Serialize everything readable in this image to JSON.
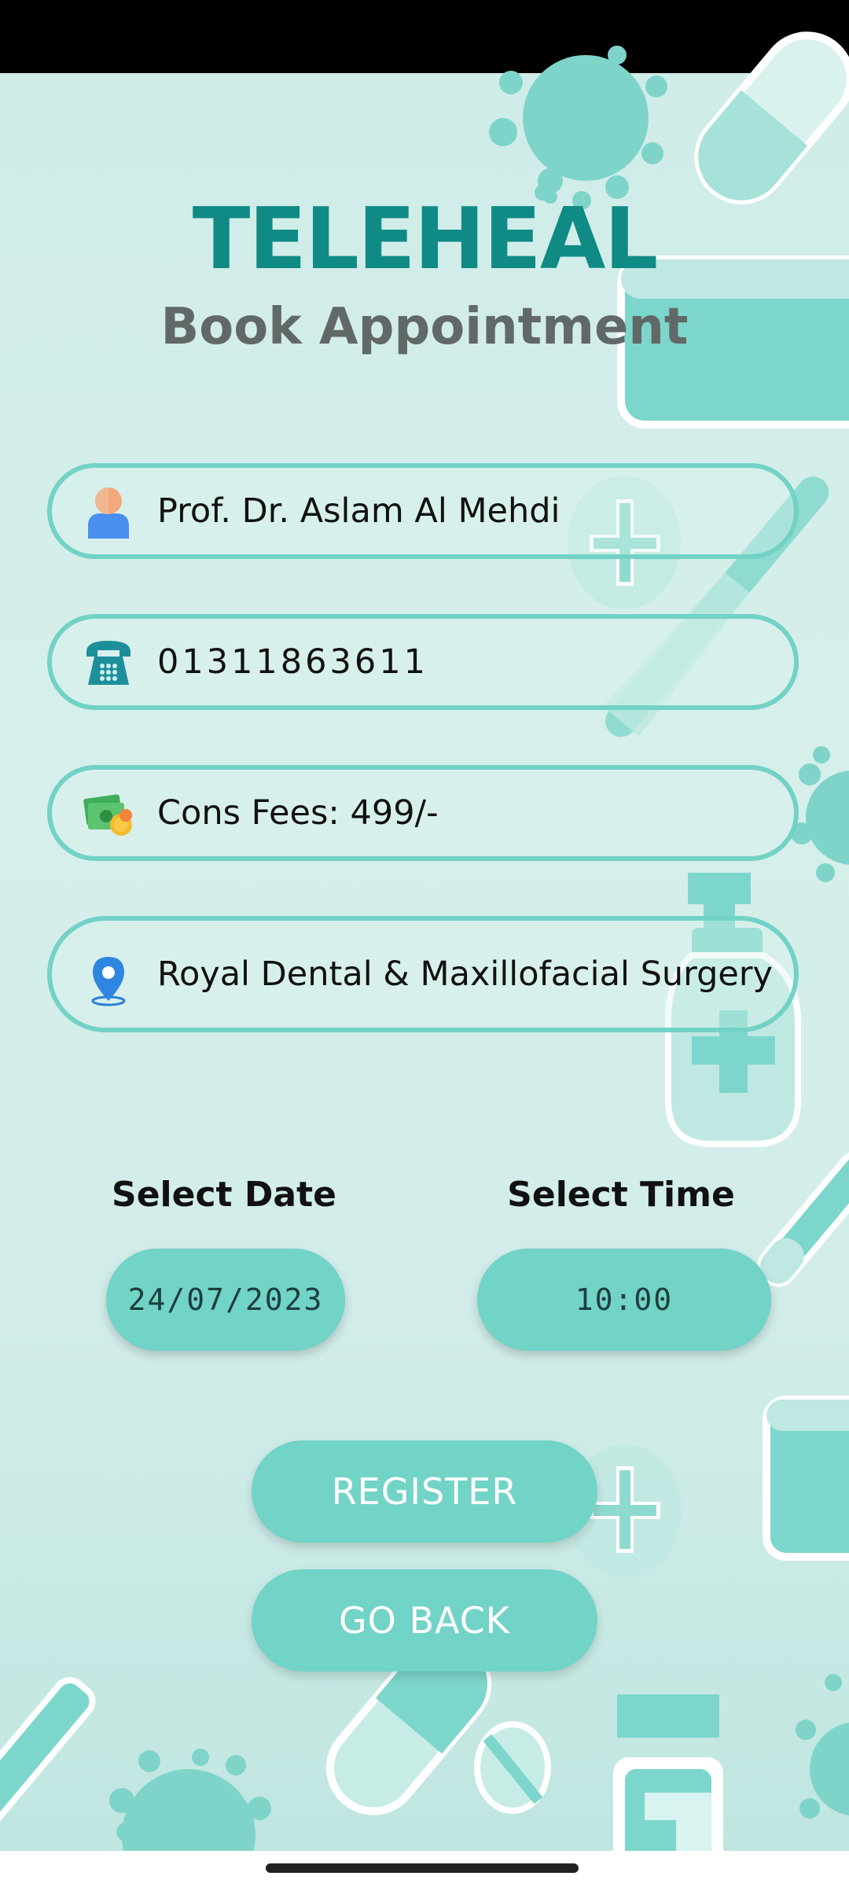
{
  "app": {
    "name": "TELEHEAL",
    "page_title": "Book Appointment"
  },
  "doctor": {
    "name": "Prof. Dr. Aslam Al Mehdi",
    "phone": "01311863611",
    "fees": "Cons Fees: 499/-",
    "location": "Royal Dental & Maxillofacial Surgery"
  },
  "icons": {
    "doctor": "person-icon",
    "phone": "telephone-icon",
    "fees": "money-icon",
    "location": "location-pin-icon"
  },
  "schedule": {
    "date_label": "Select Date",
    "date_value": "24/07/2023",
    "time_label": "Select Time",
    "time_value": "10:00"
  },
  "actions": {
    "register": "REGISTER",
    "go_back": "GO BACK"
  },
  "colors": {
    "brand": "#0f8a84",
    "accent": "#72d3c7",
    "subtitle": "#616868"
  }
}
